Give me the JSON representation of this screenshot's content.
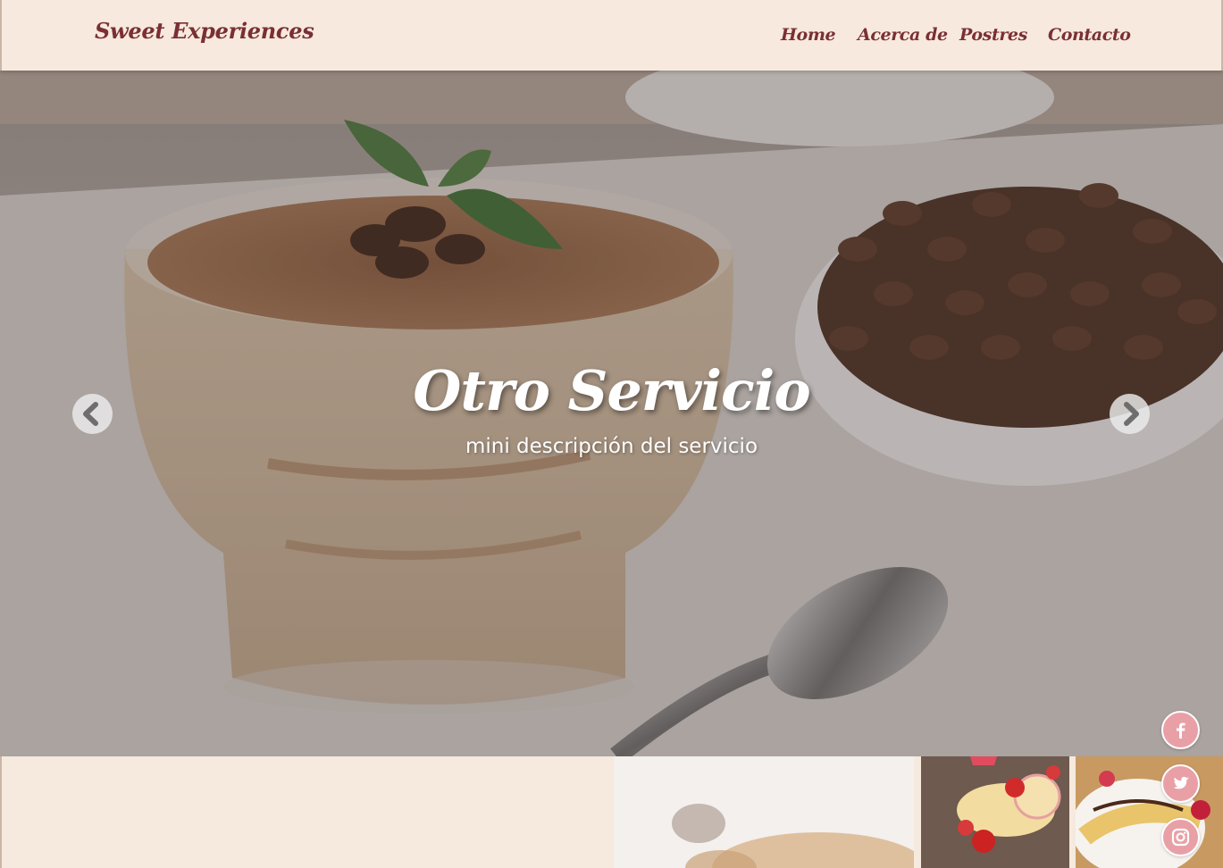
{
  "header": {
    "brand": "Sweet Experiences",
    "nav": [
      {
        "label": "Home"
      },
      {
        "label": "Acerca de"
      },
      {
        "label": "Postres"
      },
      {
        "label": "Contacto"
      }
    ]
  },
  "hero": {
    "title": "Otro Servicio",
    "subtitle": "mini descripción del servicio",
    "prev_icon": "chevron-left-icon",
    "next_icon": "chevron-right-icon"
  },
  "gallery": [
    {
      "name": "dessert-thumbnail"
    },
    {
      "name": "strawberry-roll-thumbnail"
    },
    {
      "name": "crepes-thumbnail"
    }
  ],
  "social": [
    {
      "icon": "facebook-icon"
    },
    {
      "icon": "twitter-icon"
    },
    {
      "icon": "instagram-icon"
    }
  ],
  "colors": {
    "header_bg": "#f7e9dd",
    "brand_text": "#7a2f35",
    "social_bg": "#e8a0a6"
  }
}
